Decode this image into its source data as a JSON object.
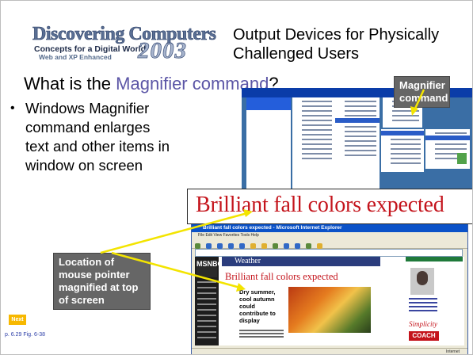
{
  "header": {
    "logo_title": "Discovering Computers",
    "logo_subtitle": "Concepts for a Digital World",
    "logo_edition": "Web and XP Enhanced",
    "logo_year": "2003",
    "slide_title": "Output Devices for Physically Challenged Users"
  },
  "question": {
    "prefix": "What is the ",
    "highlight": "Magnifier command",
    "suffix": "?"
  },
  "bullet": {
    "symbol": "•",
    "text": "Windows Magnifier command enlarges text and other items in window on screen"
  },
  "screenshot": {
    "magnified_text": "Brilliant fall colors expected",
    "browser_title": "Brilliant fall colors expected - Microsoft Internet Explorer",
    "browser_menu": "File   Edit   View   Favorites   Tools   Help",
    "page_section": "Weather",
    "page_headline": "Brilliant fall colors expected",
    "page_story": "Dry summer, cool autumn could contribute to display",
    "status_text": "Internet",
    "side_brand_1": "Simplicity",
    "side_brand_2": "COACH",
    "site_logo": "MSNBC"
  },
  "callouts": {
    "magnifier_command": "Magnifier command",
    "mouse_location": "Location of mouse pointer magnified at top of screen"
  },
  "nav": {
    "next_label": "Next",
    "page_reference": "p. 6.29 Fig. 6-38"
  },
  "colors": {
    "highlight": "#5b55a6",
    "callout_bg": "#666666",
    "arrow": "#f3e400",
    "headline_red": "#c4141c",
    "next_button": "#f7b800"
  }
}
